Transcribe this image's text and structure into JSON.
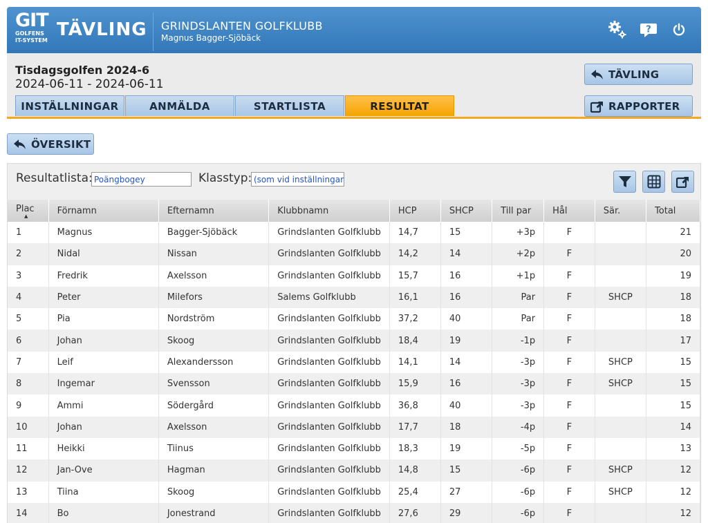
{
  "header": {
    "logo_main": "GIT",
    "logo_sub1": "GOLFENS",
    "logo_sub2": "IT-SYSTEM",
    "logo_title": "TÄVLING",
    "club": "GRINDSLANTEN GOLFKLUBB",
    "user": "Magnus Bagger-Sjöbäck",
    "icons": [
      "gears-icon",
      "help-icon",
      "power-icon"
    ]
  },
  "competition": {
    "title": "Tisdagsgolfen 2024-6",
    "dates": "2024-06-11 - 2024-06-11",
    "tabs": [
      {
        "label": "INSTÄLLNINGAR"
      },
      {
        "label": "ANMÄLDA"
      },
      {
        "label": "STARTLISTA"
      },
      {
        "label": "RESULTAT"
      }
    ],
    "active_tab": "RESULTAT",
    "tavling_button": "TÄVLING",
    "rapporter_button": "RAPPORTER"
  },
  "oversikt_button": "ÖVERSIKT",
  "filters": {
    "resultatlista_label": "Resultatlista:",
    "resultatlista_value": "Poängbogey",
    "klasstyp_label": "Klasstyp:",
    "klasstyp_value": "(som vid inställningar)"
  },
  "table": {
    "columns": [
      "Plac",
      "Förnamn",
      "Efternamn",
      "Klubbnamn",
      "HCP",
      "SHCP",
      "Till par",
      "Hål",
      "Sär.",
      "Total"
    ],
    "rows": [
      [
        "1",
        "Magnus",
        "Bagger-Sjöbäck",
        "Grindslanten Golfklubb",
        "14,7",
        "15",
        "+3p",
        "F",
        "",
        "21"
      ],
      [
        "2",
        "Nidal",
        "Nissan",
        "Grindslanten Golfklubb",
        "14,2",
        "14",
        "+2p",
        "F",
        "",
        "20"
      ],
      [
        "3",
        "Fredrik",
        "Axelsson",
        "Grindslanten Golfklubb",
        "15,7",
        "16",
        "+1p",
        "F",
        "",
        "19"
      ],
      [
        "4",
        "Peter",
        "Milefors",
        "Salems Golfklubb",
        "16,1",
        "16",
        "Par",
        "F",
        "SHCP",
        "18"
      ],
      [
        "5",
        "Pia",
        "Nordström",
        "Grindslanten Golfklubb",
        "37,2",
        "40",
        "Par",
        "F",
        "",
        "18"
      ],
      [
        "6",
        "Johan",
        "Skoog",
        "Grindslanten Golfklubb",
        "18,4",
        "19",
        "-1p",
        "F",
        "",
        "17"
      ],
      [
        "7",
        "Leif",
        "Alexandersson",
        "Grindslanten Golfklubb",
        "14,1",
        "14",
        "-3p",
        "F",
        "SHCP",
        "15"
      ],
      [
        "8",
        "Ingemar",
        "Svensson",
        "Grindslanten Golfklubb",
        "15,9",
        "16",
        "-3p",
        "F",
        "SHCP",
        "15"
      ],
      [
        "9",
        "Ammi",
        "Södergård",
        "Grindslanten Golfklubb",
        "36,8",
        "40",
        "-3p",
        "F",
        "",
        "15"
      ],
      [
        "10",
        "Johan",
        "Axelsson",
        "Grindslanten Golfklubb",
        "17,7",
        "18",
        "-4p",
        "F",
        "",
        "14"
      ],
      [
        "11",
        "Heikki",
        "Tiinus",
        "Grindslanten Golfklubb",
        "18,3",
        "19",
        "-5p",
        "F",
        "",
        "13"
      ],
      [
        "12",
        "Jan-Ove",
        "Hagman",
        "Grindslanten Golfklubb",
        "14,8",
        "15",
        "-6p",
        "F",
        "SHCP",
        "12"
      ],
      [
        "13",
        "Tiina",
        "Skoog",
        "Grindslanten Golfklubb",
        "25,4",
        "27",
        "-6p",
        "F",
        "SHCP",
        "12"
      ],
      [
        "14",
        "Bo",
        "Jonestrand",
        "Grindslanten Golfklubb",
        "27,6",
        "29",
        "-6p",
        "F",
        "",
        "12"
      ]
    ]
  }
}
